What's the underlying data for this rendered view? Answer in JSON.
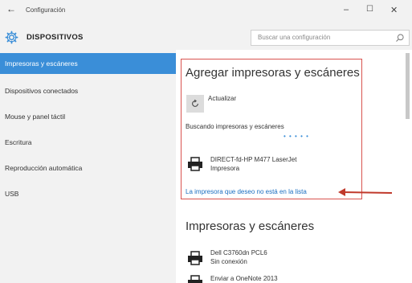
{
  "window": {
    "title": "Configuración",
    "back_label": "←",
    "min_label": "–",
    "max_label": "☐",
    "close_label": "✕"
  },
  "header": {
    "title": "DISPOSITIVOS",
    "search_placeholder": "Buscar una configuración",
    "gear_icon": "gear-icon",
    "search_icon": "search-icon"
  },
  "sidebar": {
    "items": [
      {
        "label": "Impresoras y escáneres",
        "active": true
      },
      {
        "label": "Dispositivos conectados",
        "active": false
      },
      {
        "label": "Mouse y panel táctil",
        "active": false
      },
      {
        "label": "Escritura",
        "active": false
      },
      {
        "label": "Reproducción automática",
        "active": false
      },
      {
        "label": "USB",
        "active": false
      }
    ]
  },
  "main": {
    "add_title": "Agregar impresoras y escáneres",
    "refresh_label": "Actualizar",
    "searching_label": "Buscando impresoras y escáneres",
    "progress_dots": "• • • • •",
    "found_device": {
      "name": "DIRECT-fd-HP M477 LaserJet",
      "type": "Impresora"
    },
    "not_listed_link": "La impresora que deseo no está en la lista",
    "list_title": "Impresoras y escáneres",
    "devices": [
      {
        "name": "Dell C3760dn PCL6",
        "status": "Sin conexión"
      },
      {
        "name": "Enviar a OneNote 2013",
        "status": ""
      }
    ]
  },
  "colors": {
    "accent": "#3a8ed8",
    "highlight_box": "#d9534f",
    "link": "#1a6ec0",
    "arrow": "#c0392b"
  }
}
